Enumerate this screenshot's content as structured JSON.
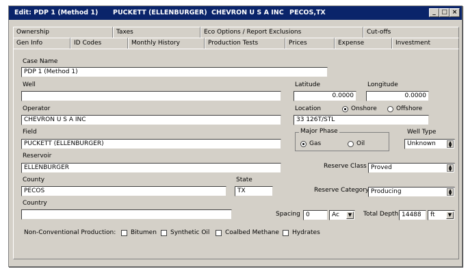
{
  "title": {
    "edit": "Edit: PDP 1 (Method 1)",
    "lease": "PUCKETT (ELLENBURGER)",
    "operator": "CHEVRON U S A INC",
    "county_state": "PECOS,TX"
  },
  "tabs_row1": [
    "Ownership",
    "Taxes",
    "Eco Options / Report Exclusions",
    "Cut-offs"
  ],
  "tabs_row2": [
    "Gen Info",
    "ID Codes",
    "Monthly History",
    "Production Tests",
    "Prices",
    "Expense",
    "Investment"
  ],
  "form": {
    "case_name_label": "Case Name",
    "case_name": "PDP 1 (Method 1)",
    "well_label": "Well",
    "well": "",
    "latitude_label": "Latitude",
    "latitude": "0.0000",
    "longitude_label": "Longitude",
    "longitude": "0.0000",
    "operator_label": "Operator",
    "operator": "CHEVRON U S A INC",
    "location_label": "Location",
    "onshore_label": "Onshore",
    "offshore_label": "Offshore",
    "location": "33 126T/STL",
    "field_label": "Field",
    "field": "PUCKETT (ELLENBURGER)",
    "major_phase_label": "Major Phase",
    "gas_label": "Gas",
    "oil_label": "Oil",
    "well_type_label": "Well Type",
    "well_type": "Unknown",
    "reservoir_label": "Reservoir",
    "reservoir": "ELLENBURGER",
    "reserve_class_label": "Reserve Class",
    "reserve_class": "Proved",
    "county_label": "County",
    "county": "PECOS",
    "state_label": "State",
    "state": "TX",
    "reserve_category_label": "Reserve Category",
    "reserve_category": "Producing",
    "country_label": "Country",
    "country": "",
    "spacing_label": "Spacing",
    "spacing": "0",
    "spacing_unit": "Ac",
    "total_depth_label": "Total Depth",
    "total_depth": "14488",
    "depth_unit": "ft",
    "nonconv_label": "Non-Conventional Production:",
    "bitumen_label": "Bitumen",
    "synthetic_oil_label": "Synthetic Oil",
    "coalbed_label": "Coalbed Methane",
    "hydrates_label": "Hydrates"
  }
}
